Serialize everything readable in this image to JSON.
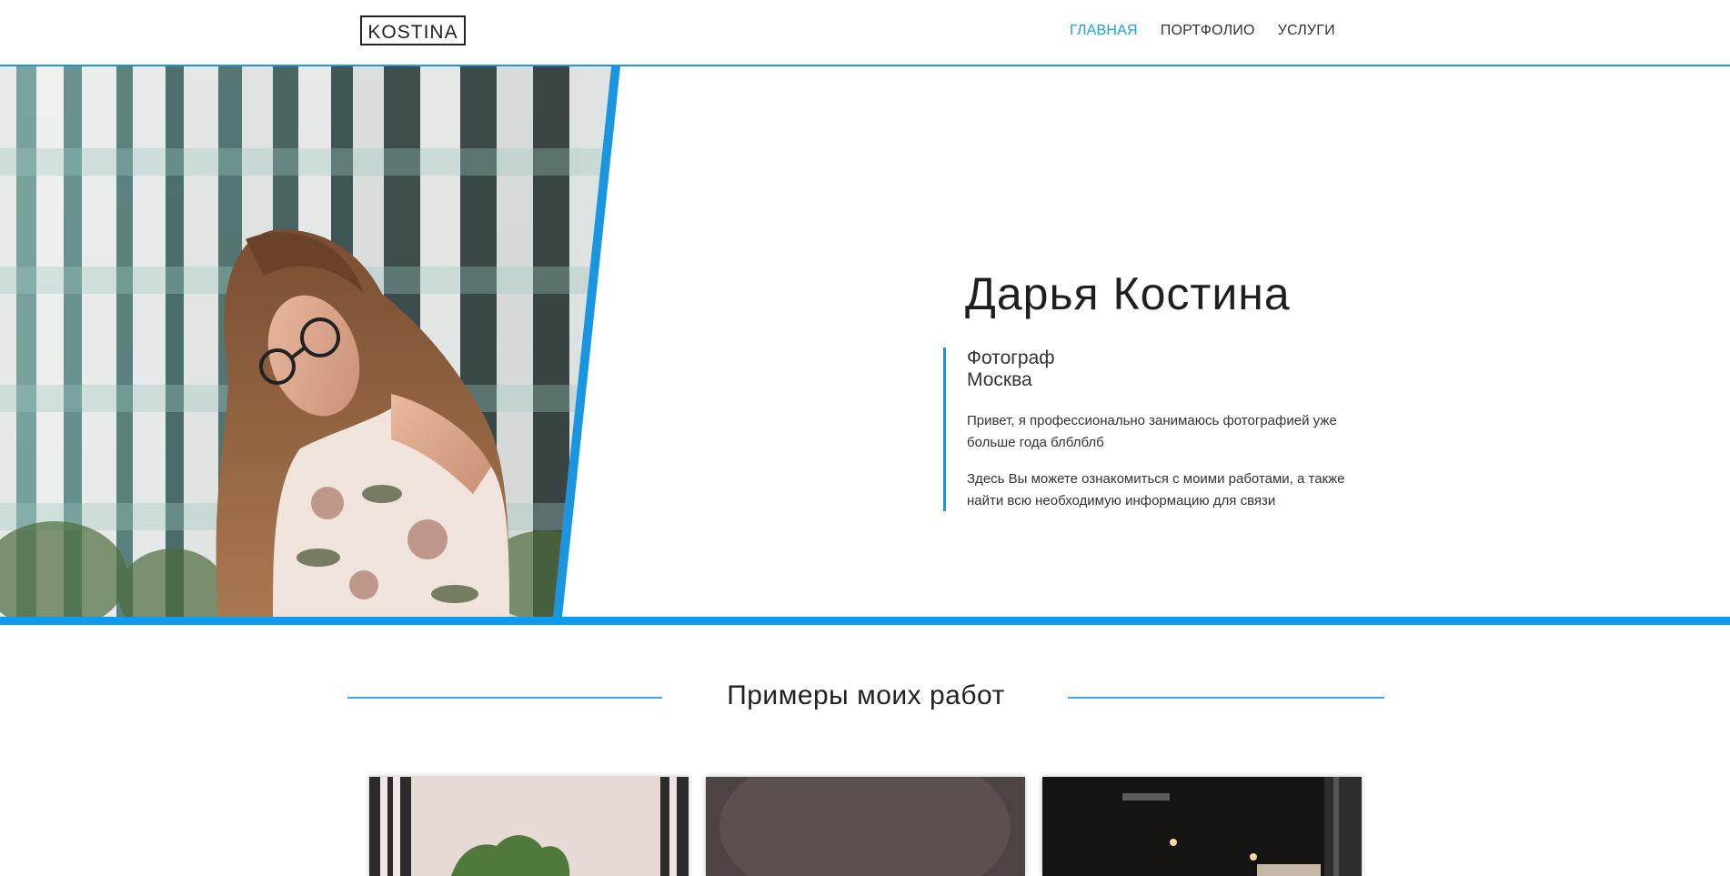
{
  "header": {
    "logo": "KOSTINA",
    "nav": [
      {
        "label": "ГЛАВНАЯ",
        "active": true
      },
      {
        "label": "ПОРТФОЛИО",
        "active": false
      },
      {
        "label": "УСЛУГИ",
        "active": false
      }
    ]
  },
  "hero": {
    "name": "Дарья Костина",
    "role": "Фотограф",
    "city": "Москва",
    "bio1": "Привет, я профессионально занимаюсь фотографией уже больше года блблблб",
    "bio2": "Здесь Вы можете ознакомиться с моими работами, а также найти всю необходимую информацию для связи"
  },
  "works": {
    "title": "Примеры моих работ"
  },
  "colors": {
    "accent": "#1a96e0",
    "active_nav": "#17a2e8"
  }
}
